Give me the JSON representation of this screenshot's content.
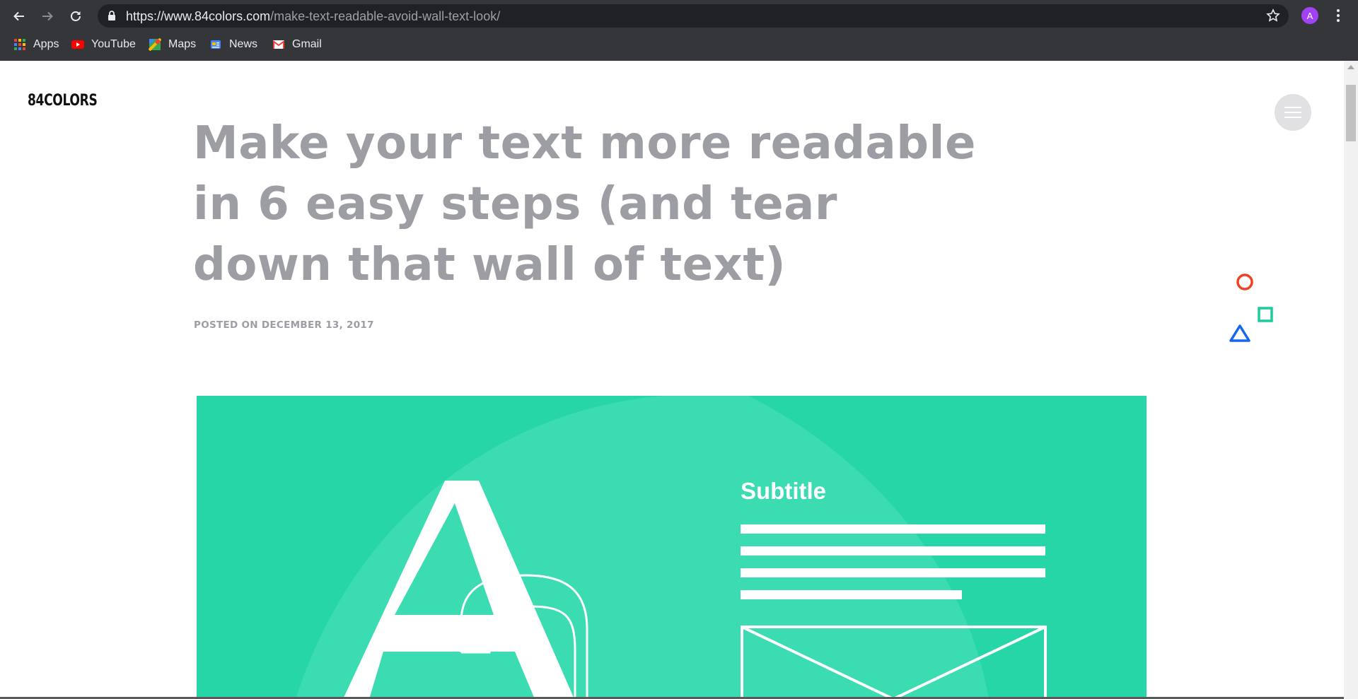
{
  "browser": {
    "url_host": "https://www.84colors.com",
    "url_path": "/make-text-readable-avoid-wall-text-look/",
    "profile_initial": "A",
    "bookmarks": [
      {
        "label": "Apps",
        "icon": "apps-grid-icon"
      },
      {
        "label": "YouTube",
        "icon": "youtube-icon"
      },
      {
        "label": "Maps",
        "icon": "maps-icon"
      },
      {
        "label": "News",
        "icon": "news-icon"
      },
      {
        "label": "Gmail",
        "icon": "gmail-icon"
      }
    ]
  },
  "site": {
    "logo": "84COLORS",
    "menu_icon": "hamburger-menu-icon"
  },
  "article": {
    "title": "Make your text more readable in 6 easy steps (and tear down that wall of text)",
    "meta": "POSTED ON DECEMBER 13, 2017",
    "hero_subtitle": "Subtitle"
  },
  "colors": {
    "hero_bg": "#27d6a6",
    "title": "#9d9da4",
    "circle_shape": "#f0401f",
    "square_shape": "#1ecba0",
    "triangle_shape": "#1565f0"
  }
}
